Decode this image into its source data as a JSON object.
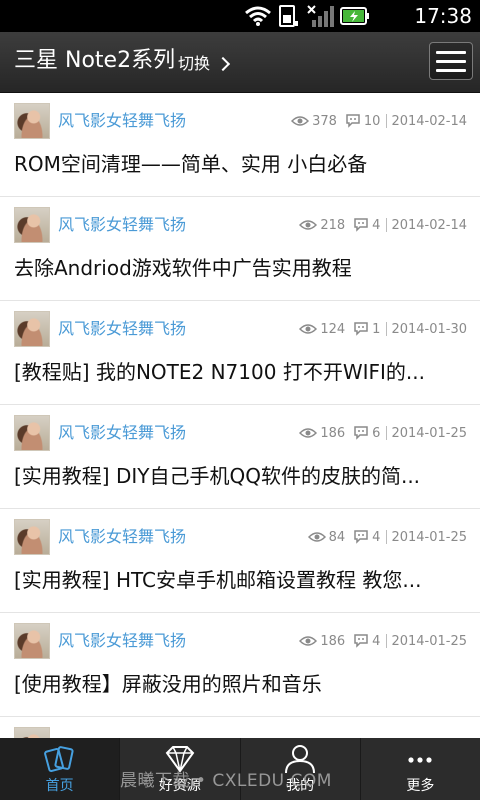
{
  "status_bar": {
    "time": "17:38",
    "icons": [
      "wifi-icon",
      "sim-icon",
      "signal-icon",
      "battery-icon"
    ]
  },
  "app_bar": {
    "title": "三星 Note2系列",
    "switch_label": "切换"
  },
  "articles": [
    {
      "author": "风飞影女轻舞飞扬",
      "views": "378",
      "comments": "10",
      "date": "2014-02-14",
      "title": "ROM空间清理——简单、实用 小白必备"
    },
    {
      "author": "风飞影女轻舞飞扬",
      "views": "218",
      "comments": "4",
      "date": "2014-02-14",
      "title": "去除Andriod游戏软件中广告实用教程"
    },
    {
      "author": "风飞影女轻舞飞扬",
      "views": "124",
      "comments": "1",
      "date": "2014-01-30",
      "title": "[教程贴] 我的NOTE2 N7100 打不开WIFI的..."
    },
    {
      "author": "风飞影女轻舞飞扬",
      "views": "186",
      "comments": "6",
      "date": "2014-01-25",
      "title": "[实用教程] DIY自己手机QQ软件的皮肤的简..."
    },
    {
      "author": "风飞影女轻舞飞扬",
      "views": "84",
      "comments": "4",
      "date": "2014-01-25",
      "title": "[实用教程] HTC安卓手机邮箱设置教程 教您..."
    },
    {
      "author": "风飞影女轻舞飞扬",
      "views": "186",
      "comments": "4",
      "date": "2014-01-25",
      "title": "[使用教程】屏蔽没用的照片和音乐"
    }
  ],
  "tab_bar": {
    "tabs": [
      {
        "label": "首页",
        "icon": "home-cards-icon",
        "active": true
      },
      {
        "label": "好资源",
        "icon": "diamond-icon",
        "active": false
      },
      {
        "label": "我的",
        "icon": "user-icon",
        "active": false
      },
      {
        "label": "更多",
        "icon": "more-dots-icon",
        "active": false
      }
    ]
  },
  "watermark": "晨曦下载 • CXLEDU.COM",
  "colors": {
    "accent": "#4a9ad6",
    "active_tab": "#46a0e0",
    "app_bar": "#303030",
    "tab_bar": "#2c2c2c"
  }
}
